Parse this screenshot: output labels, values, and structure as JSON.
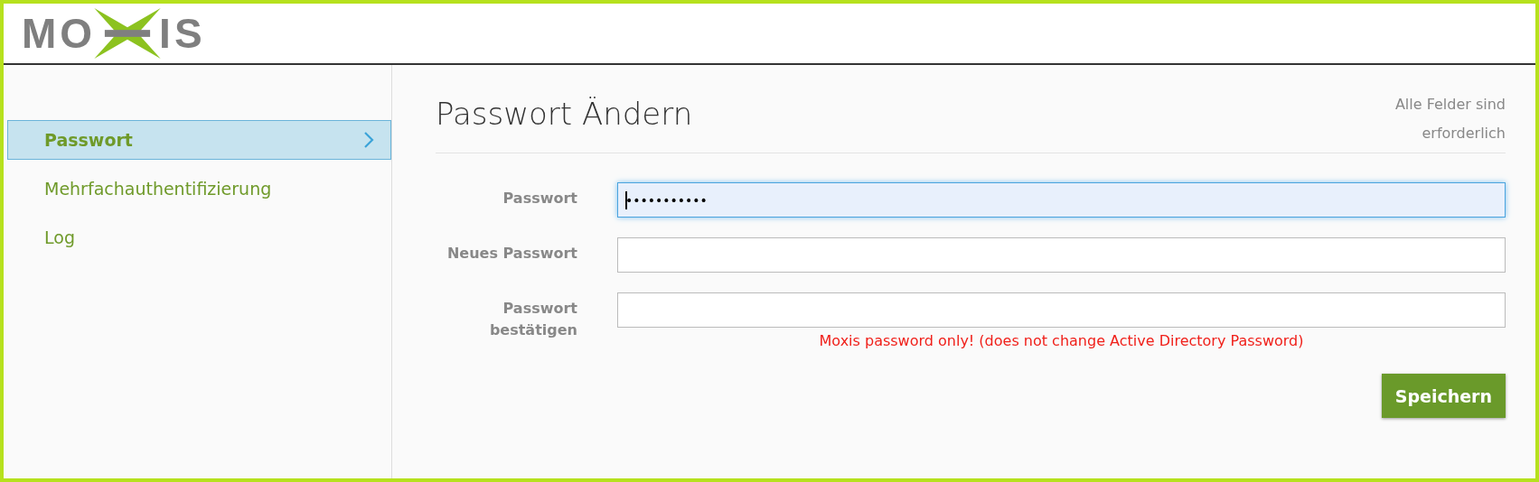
{
  "logo": {
    "left": "MO",
    "right": "IS"
  },
  "sidebar": {
    "items": [
      {
        "label": "Passwort",
        "selected": true
      },
      {
        "label": "Mehrfachauthentifizierung",
        "selected": false
      },
      {
        "label": "Log",
        "selected": false
      }
    ]
  },
  "form": {
    "title": "Passwort Ändern",
    "note": "Alle Felder sind erforderlich",
    "fields": [
      {
        "label": "Passwort",
        "value": "•••••••••••",
        "focused": true
      },
      {
        "label": "Neues Passwort",
        "focused": false
      },
      {
        "label": "Passwort bestätigen",
        "focused": false,
        "hint": "Moxis password only! (does not change Active Directory Password)"
      }
    ],
    "button": "Speichern"
  }
}
